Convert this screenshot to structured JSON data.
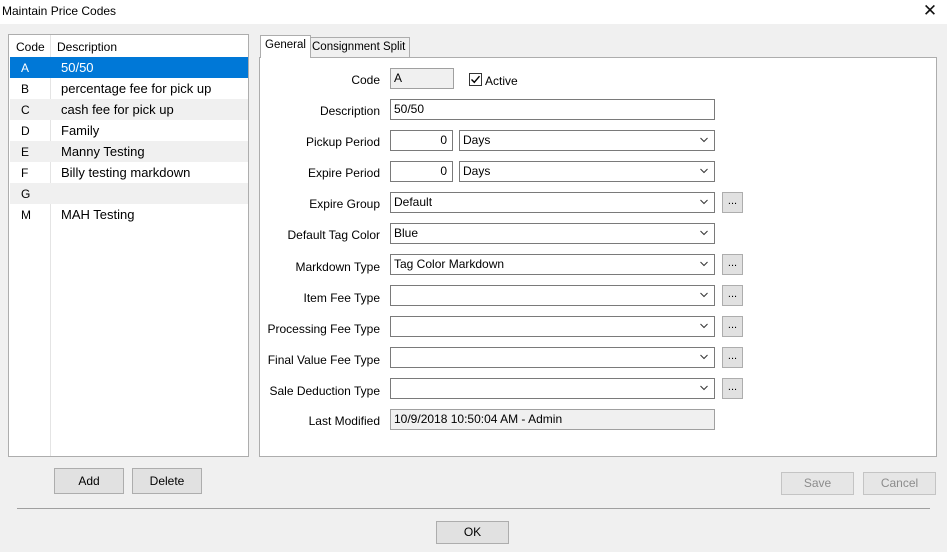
{
  "window": {
    "title": "Maintain Price Codes"
  },
  "list": {
    "headers": {
      "code": "Code",
      "description": "Description"
    },
    "rows": [
      {
        "code": "A",
        "description": "50/50"
      },
      {
        "code": "B",
        "description": "percentage fee for pick up"
      },
      {
        "code": "C",
        "description": "cash fee for pick up"
      },
      {
        "code": "D",
        "description": "Family"
      },
      {
        "code": "E",
        "description": "Manny Testing"
      },
      {
        "code": "F",
        "description": "Billy testing markdown"
      },
      {
        "code": "G",
        "description": ""
      },
      {
        "code": "M",
        "description": "MAH Testing"
      }
    ]
  },
  "buttons": {
    "add": "Add",
    "delete": "Delete",
    "save": "Save",
    "cancel": "Cancel",
    "ok": "OK",
    "ellipsis": "..."
  },
  "tabs": {
    "general": "General",
    "consignment": "Consignment Split"
  },
  "form": {
    "code_label": "Code",
    "code_value": "A",
    "active_label": "Active",
    "description_label": "Description",
    "description_value": "50/50",
    "pickup_label": "Pickup Period",
    "pickup_value": "0",
    "pickup_unit": "Days",
    "expire_label": "Expire Period",
    "expire_value": "0",
    "expire_unit": "Days",
    "expire_group_label": "Expire Group",
    "expire_group_value": "Default",
    "tag_color_label": "Default Tag Color",
    "tag_color_value": "Blue",
    "markdown_label": "Markdown Type",
    "markdown_value": "Tag Color Markdown",
    "item_fee_label": "Item Fee Type",
    "item_fee_value": "",
    "processing_fee_label": "Processing Fee Type",
    "processing_fee_value": "",
    "final_value_fee_label": "Final Value Fee Type",
    "final_value_fee_value": "",
    "sale_deduction_label": "Sale Deduction Type",
    "sale_deduction_value": "",
    "last_modified_label": "Last Modified",
    "last_modified_value": "10/9/2018 10:50:04 AM - Admin"
  },
  "colors": {
    "selection": "#0078d7",
    "window_bg": "#f0f0f0"
  },
  "icons": {
    "close": "close-icon",
    "dropdown": "chevron-down-icon",
    "checkbox": "checkmark-icon"
  }
}
